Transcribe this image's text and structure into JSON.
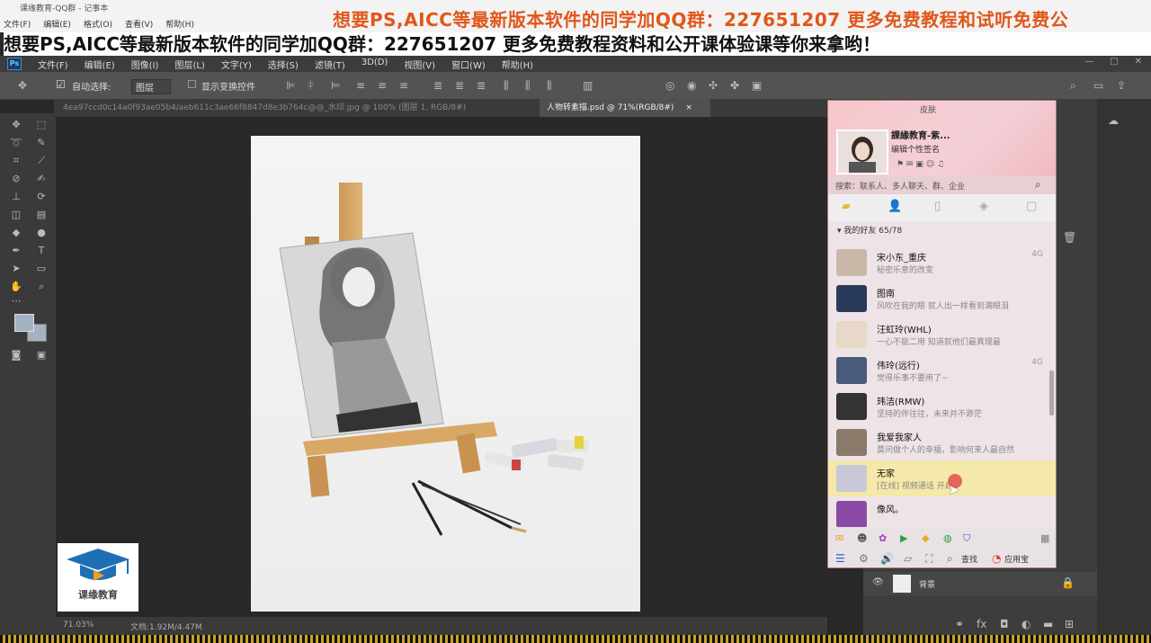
{
  "notepad": {
    "title": "课缘教育-QQ群 - 记事本",
    "menu": [
      "文件(F)",
      "编辑(E)",
      "格式(O)",
      "查看(V)",
      "帮助(H)"
    ]
  },
  "banner_top": "想要PS,AICC等最新版本软件的同学加QQ群：227651207 更多免费教程和试听免费公",
  "banner_main": "想要PS,AICC等最新版本软件的同学加QQ群：227651207 更多免费教程资料和公开课体验课等你来拿哟！",
  "ps": {
    "logo": "Ps",
    "menus": [
      "文件(F)",
      "编辑(E)",
      "图像(I)",
      "图层(L)",
      "文字(Y)",
      "选择(S)",
      "滤镜(T)",
      "3D(D)",
      "视图(V)",
      "窗口(W)",
      "帮助(H)"
    ],
    "window_controls": [
      "—",
      "□",
      "✕"
    ],
    "options": {
      "auto_select": "自动选择:",
      "layer_dropdown": "图层",
      "transform_controls": "显示变换控件"
    },
    "tabs": {
      "inactive": "4ea97ccd0c14a0f93ae05b4/aeb611c3ae66f8847d8e3b764c@@_水印.jpg @ 100% (图层 1, RGB/8#)",
      "active": "人物转素描.psd @ 71%(RGB/8#)",
      "close": "×"
    },
    "status": {
      "zoom": "71.03%",
      "doc": "文档:1.92M/4.47M"
    },
    "layer_name": "背景"
  },
  "logo_text": "课缘教育",
  "qq": {
    "header_label": "皮肤",
    "profile_name": "課緣教育-紫...",
    "signature": "编辑个性签名",
    "search_placeholder": "搜索：联系人、多人聊天、群、企业",
    "group_label": "我的好友 65/78",
    "friends": [
      {
        "name": "宋小东_重庆",
        "status": "秘密乐意的改变",
        "time": "4G",
        "color": "#c9b8a8"
      },
      {
        "name": "图南",
        "status": "风吹在我的眼 就人出一样看到满眼泪",
        "time": "",
        "color": "#2a3a5a"
      },
      {
        "name": "汪虹玲(WHL)",
        "status": "一心不能二用 知道就他们最真理最",
        "time": "",
        "color": "#e8d8c8"
      },
      {
        "name": "伟玲(远行)",
        "status": "觉得乐事不要用了~",
        "time": "4G",
        "color": "#4a5a7a"
      },
      {
        "name": "玮洁(RMW)",
        "status": "坚持的伴往往，未来并不渺茫",
        "time": "",
        "color": "#333333"
      },
      {
        "name": "我爱我家人",
        "status": "莫问做个人的幸福，影响何来人最自然",
        "time": "",
        "color": "#8a7a6a"
      },
      {
        "name": "无家",
        "status": "[在线] 视频通话 开启",
        "time": "",
        "color": "#c8c8d8",
        "highlight": true
      },
      {
        "name": "像风。",
        "status": "",
        "time": "",
        "color": "#8a4aa8"
      }
    ],
    "find_label": "查找",
    "apps_label": "应用宝"
  },
  "colors": {
    "ps_bg": "#282828",
    "ps_panel": "#3a3a3a",
    "banner_orange": "#e0571a",
    "qq_highlight": "#f4e9a8"
  }
}
